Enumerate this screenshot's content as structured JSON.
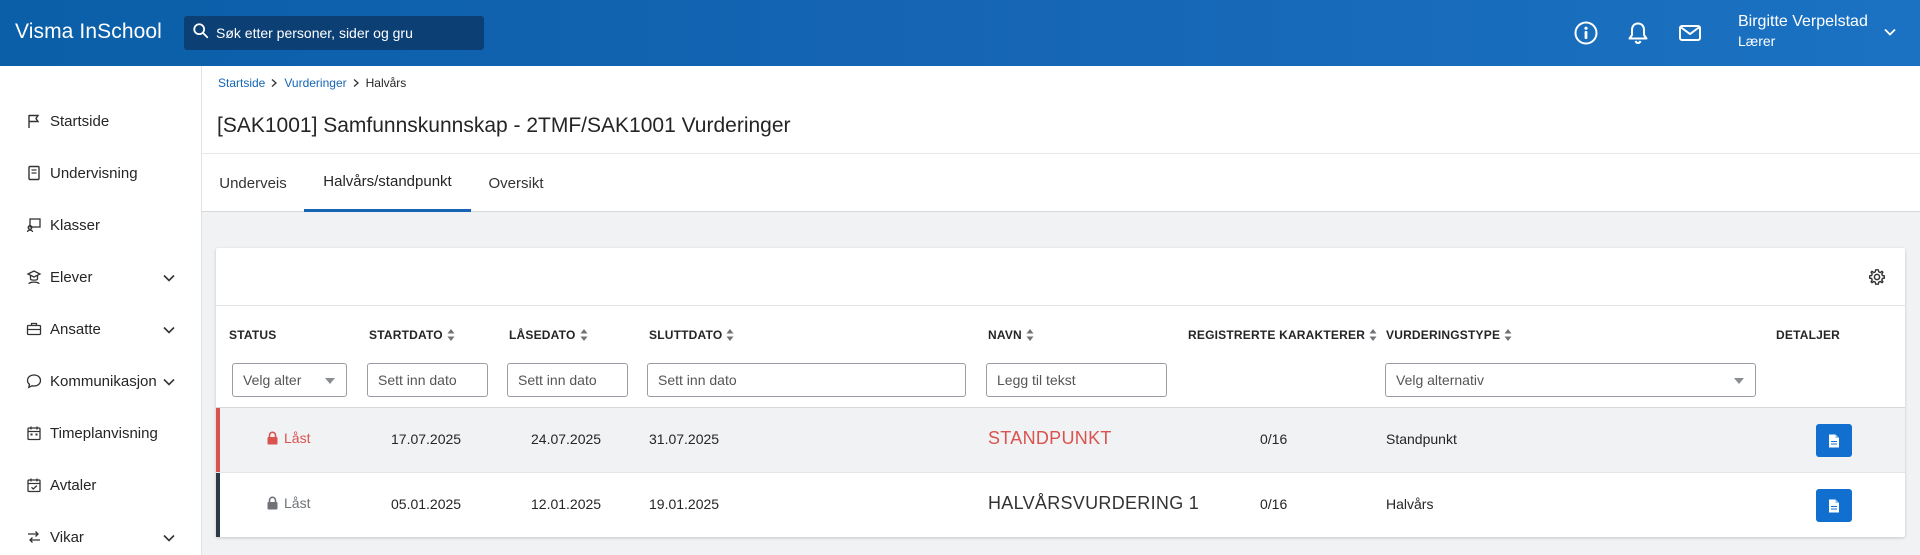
{
  "header": {
    "brand": "Visma InSchool",
    "search_placeholder": "Søk etter personer, sider og gru",
    "icons": [
      "info-icon",
      "bell-icon",
      "mail-icon"
    ],
    "user_name": "Birgitte Verpelstad",
    "user_role": "Lærer"
  },
  "sidebar": {
    "items": [
      {
        "label": "Startside",
        "icon": "flag-icon",
        "expandable": false
      },
      {
        "label": "Undervisning",
        "icon": "book-icon",
        "expandable": false
      },
      {
        "label": "Klasser",
        "icon": "class-icon",
        "expandable": false
      },
      {
        "label": "Elever",
        "icon": "students-icon",
        "expandable": true
      },
      {
        "label": "Ansatte",
        "icon": "briefcase-icon",
        "expandable": true
      },
      {
        "label": "Kommunikasjon",
        "icon": "chat-icon",
        "expandable": true
      },
      {
        "label": "Timeplanvisning",
        "icon": "calendar-icon",
        "expandable": false
      },
      {
        "label": "Avtaler",
        "icon": "calendar-check-icon",
        "expandable": false
      },
      {
        "label": "Vikar",
        "icon": "swap-icon",
        "expandable": true
      }
    ]
  },
  "breadcrumb": {
    "items": [
      "Startside",
      "Vurderinger"
    ],
    "current": "Halvårs"
  },
  "page_title": "[SAK1001] Samfunnskunnskap - 2TMF/SAK1001 Vurderinger",
  "tabs": {
    "items": [
      "Underveis",
      "Halvårs/standpunkt",
      "Oversikt"
    ],
    "active": "Halvårs/standpunkt"
  },
  "table": {
    "headers": {
      "status": "STATUS",
      "startdato": "STARTDATO",
      "lasedato": "LÅSEDATO",
      "sluttdato": "SLUTTDATO",
      "navn": "NAVN",
      "registrerte": "REGISTRERTE KARAKTERER",
      "vurderingstype": "VURDERINGSTYPE",
      "detaljer": "DETALJER"
    },
    "filters": {
      "status_select": "Velg alter",
      "startdato": "Sett inn dato",
      "lasedato": "Sett inn dato",
      "sluttdato": "Sett inn dato",
      "navn": "Legg til tekst",
      "vurderingstype_select": "Velg alternativ"
    },
    "rows": [
      {
        "status": "Låst",
        "startdato": "17.07.2025",
        "lasedato": "24.07.2025",
        "sluttdato": "31.07.2025",
        "navn": "STANDPUNKT",
        "registrerte": "0/16",
        "vurderingstype": "Standpunkt",
        "accent": "#d9534f"
      },
      {
        "status": "Låst",
        "startdato": "05.01.2025",
        "lasedato": "12.01.2025",
        "sluttdato": "19.01.2025",
        "navn": "HALVÅRSVURDERING 1",
        "registrerte": "0/16",
        "vurderingstype": "Halvårs",
        "accent": "#2b3a46"
      }
    ]
  },
  "colors": {
    "brand_blue": "#1565b4",
    "locked_red": "#d9534f",
    "muted_grey": "#6f7378",
    "button_blue": "#1170cf"
  }
}
